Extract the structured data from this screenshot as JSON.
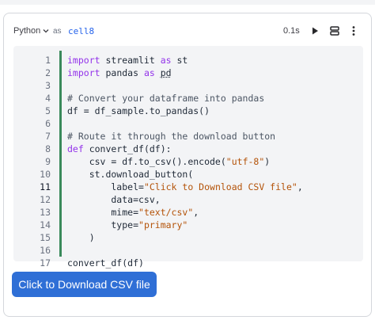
{
  "header": {
    "language": "Python",
    "as_word": "as",
    "cell_name": "cell8",
    "exec_time": "0.1s",
    "icons": [
      "chevron-down-icon",
      "play-icon",
      "stack-icon",
      "more-vertical-icon"
    ]
  },
  "editor": {
    "active_line": 11,
    "change_bar_color": "#3a8a5b",
    "line_numbers": [
      "1",
      "2",
      "3",
      "4",
      "5",
      "6",
      "7",
      "8",
      "9",
      "10",
      "11",
      "12",
      "13",
      "14",
      "15",
      "16",
      "17"
    ],
    "lines": [
      [
        {
          "t": "import",
          "c": "kw"
        },
        {
          "t": " streamlit "
        },
        {
          "t": "as",
          "c": "kw"
        },
        {
          "t": " st"
        }
      ],
      [
        {
          "t": "import",
          "c": "kw"
        },
        {
          "t": " pandas "
        },
        {
          "t": "as",
          "c": "kw"
        },
        {
          "t": " "
        },
        {
          "t": "pd",
          "c": "ul"
        }
      ],
      [],
      [
        {
          "t": "# Convert your dataframe into pandas",
          "c": "cm"
        }
      ],
      [
        {
          "t": "df = df_sample.to_pandas()"
        }
      ],
      [],
      [
        {
          "t": "# Route it through the download button",
          "c": "cm"
        }
      ],
      [
        {
          "t": "def",
          "c": "kw"
        },
        {
          "t": " convert_df(df):"
        }
      ],
      [
        {
          "t": "    csv = df.to_csv().encode("
        },
        {
          "t": "\"utf-8\"",
          "c": "st"
        },
        {
          "t": ")"
        }
      ],
      [
        {
          "t": "    st.download_button("
        }
      ],
      [
        {
          "t": "        label="
        },
        {
          "t": "\"Click to Download CSV file\"",
          "c": "st"
        },
        {
          "t": ","
        }
      ],
      [
        {
          "t": "        data=csv,"
        }
      ],
      [
        {
          "t": "        mime="
        },
        {
          "t": "\"text/csv\"",
          "c": "st"
        },
        {
          "t": ","
        }
      ],
      [
        {
          "t": "        type="
        },
        {
          "t": "\"primary\"",
          "c": "st"
        }
      ],
      [
        {
          "t": "    )"
        }
      ],
      [],
      [
        {
          "t": "convert_df(df)"
        }
      ]
    ]
  },
  "output": {
    "button_label": "Click to Download CSV file",
    "button_color": "#2f6fd6"
  }
}
